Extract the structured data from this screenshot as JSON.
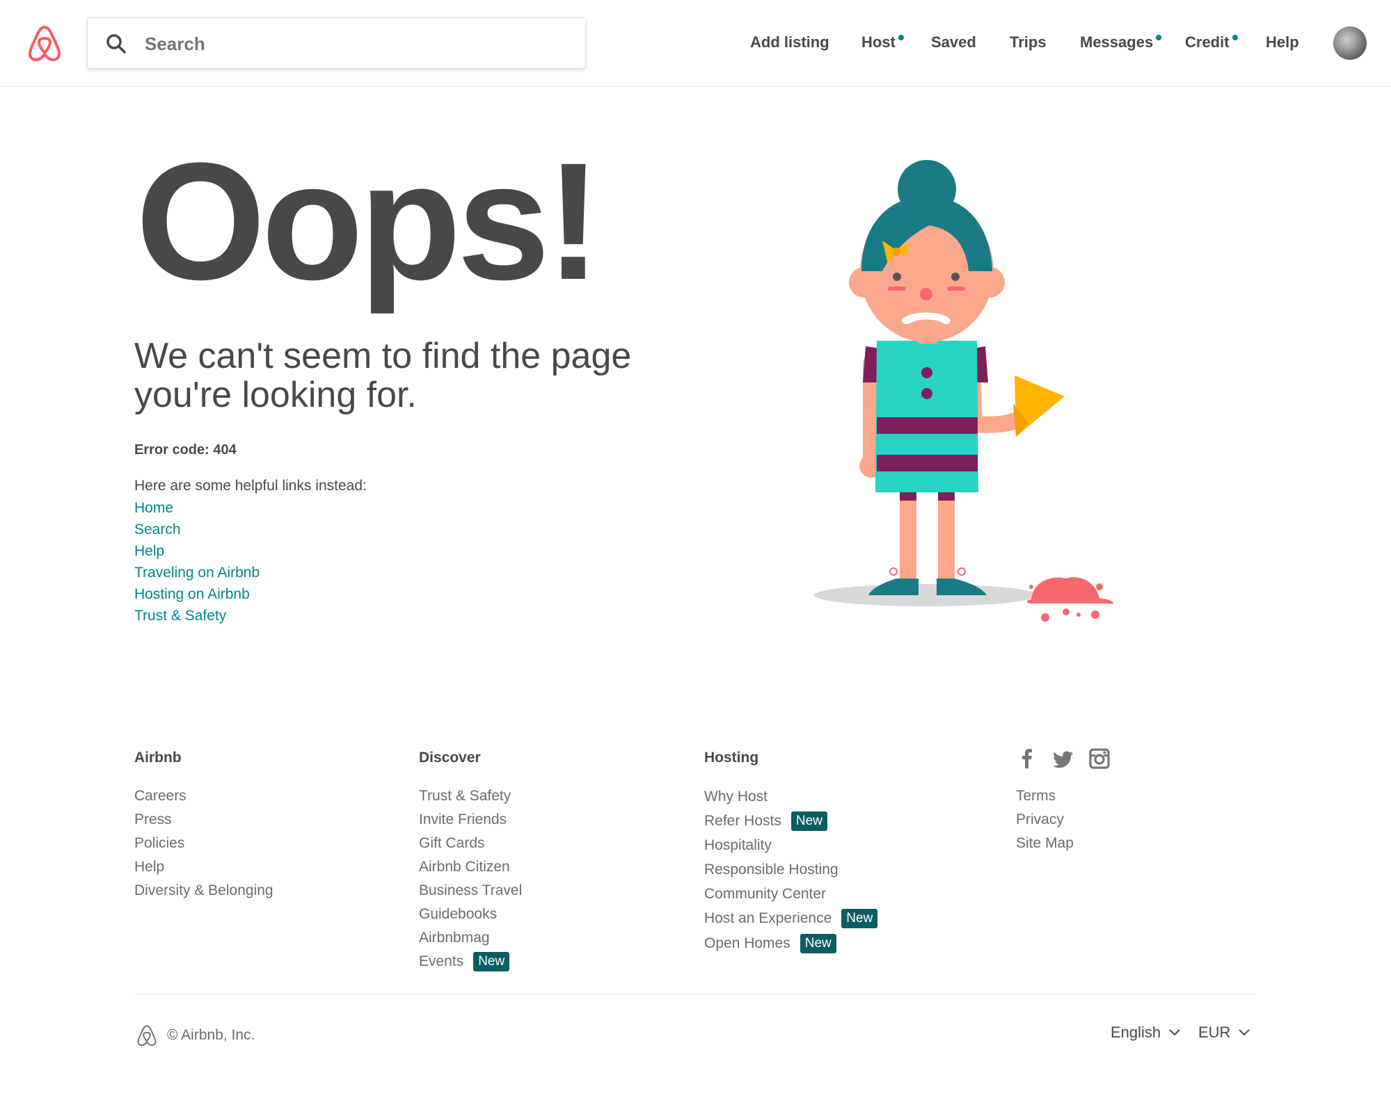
{
  "header": {
    "search_placeholder": "Search",
    "nav": [
      {
        "label": "Add listing",
        "dot": false
      },
      {
        "label": "Host",
        "dot": true
      },
      {
        "label": "Saved",
        "dot": false
      },
      {
        "label": "Trips",
        "dot": false
      },
      {
        "label": "Messages",
        "dot": true
      },
      {
        "label": "Credit",
        "dot": true
      },
      {
        "label": "Help",
        "dot": false
      }
    ]
  },
  "main": {
    "title": "Oops!",
    "subtitle": "We can't seem to find the page you're looking for.",
    "error_code": "Error code: 404",
    "helpful_intro": "Here are some helpful links instead:",
    "helpful_links": [
      "Home",
      "Search",
      "Help",
      "Traveling on Airbnb",
      "Hosting on Airbnb",
      "Trust & Safety"
    ]
  },
  "footer": {
    "columns": [
      {
        "heading": "Airbnb",
        "links": [
          {
            "label": "Careers"
          },
          {
            "label": "Press"
          },
          {
            "label": "Policies"
          },
          {
            "label": "Help"
          },
          {
            "label": "Diversity & Belonging"
          }
        ]
      },
      {
        "heading": "Discover",
        "links": [
          {
            "label": "Trust & Safety"
          },
          {
            "label": "Invite Friends"
          },
          {
            "label": "Gift Cards"
          },
          {
            "label": "Airbnb Citizen"
          },
          {
            "label": "Business Travel"
          },
          {
            "label": "Guidebooks"
          },
          {
            "label": "Airbnbmag"
          },
          {
            "label": "Events",
            "badge": "New"
          }
        ]
      },
      {
        "heading": "Hosting",
        "links": [
          {
            "label": "Why Host"
          },
          {
            "label": "Refer Hosts",
            "badge": "New"
          },
          {
            "label": "Hospitality"
          },
          {
            "label": "Responsible Hosting"
          },
          {
            "label": "Community Center"
          },
          {
            "label": "Host an Experience",
            "badge": "New"
          },
          {
            "label": "Open Homes",
            "badge": "New"
          }
        ]
      }
    ],
    "social_icons": [
      "facebook-icon",
      "twitter-icon",
      "instagram-icon"
    ],
    "legal_links": [
      "Terms",
      "Privacy",
      "Site Map"
    ],
    "copyright": "© Airbnb, Inc.",
    "language": "English",
    "currency": "EUR"
  },
  "colors": {
    "brand": "#FF5A5F",
    "link": "#008489",
    "badge": "#0D5D63",
    "text": "#484848"
  }
}
